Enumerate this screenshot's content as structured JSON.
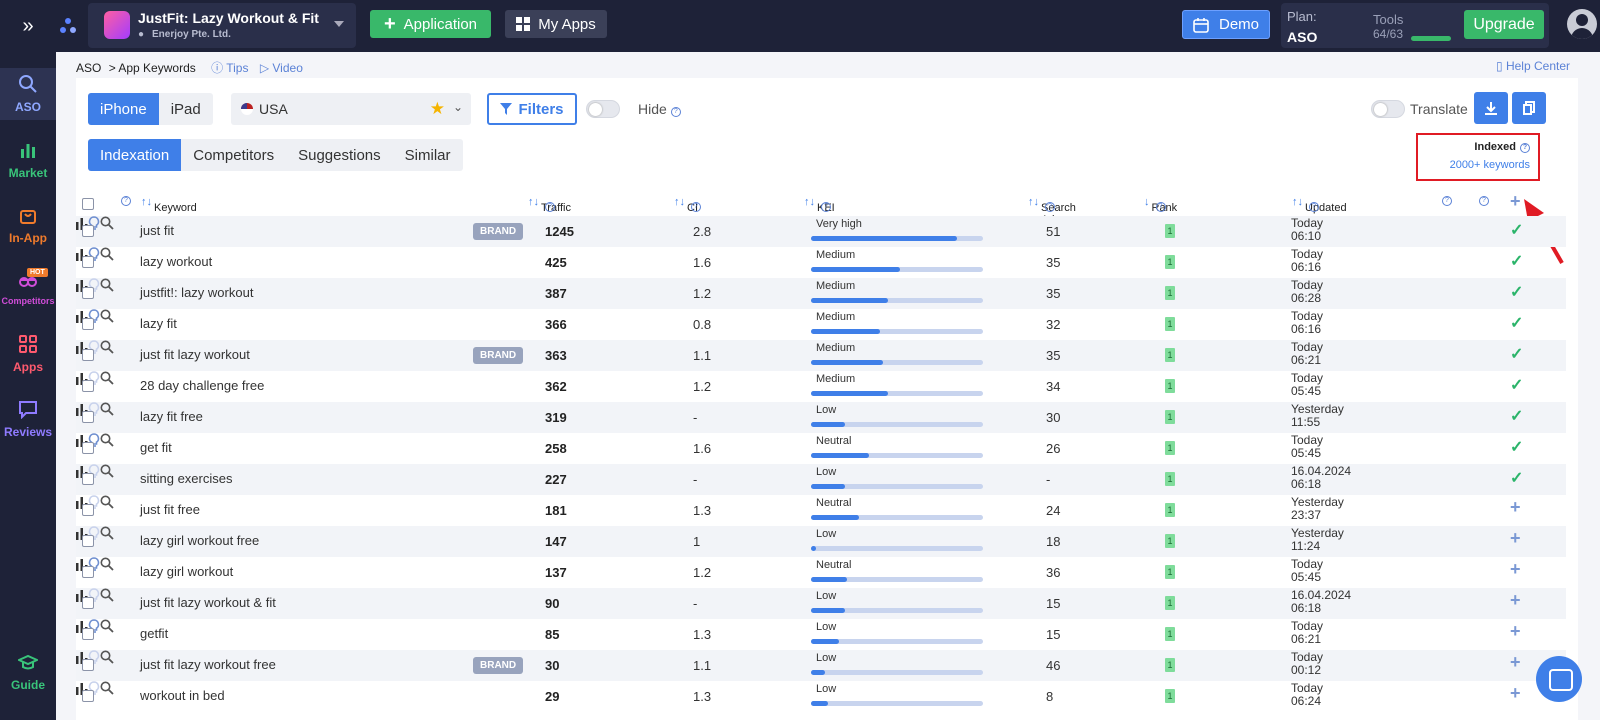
{
  "topbar": {
    "app_title": "JustFit: Lazy Workout & Fit",
    "developer": "Enerjoy Pte. Ltd.",
    "add_app_label": "Application",
    "my_apps_label": "My Apps",
    "demo_label": "Demo",
    "plan_label": "Plan:",
    "plan_value": "ASO",
    "tools_label": "Tools",
    "tools_value": "64/63",
    "upgrade_label": "Upgrade"
  },
  "sidebar": {
    "items": [
      {
        "label": "ASO",
        "icon": "search-icon",
        "color": "#8fa8ff"
      },
      {
        "label": "Market",
        "icon": "bar-chart-icon",
        "color": "#39c47a"
      },
      {
        "label": "In-App",
        "icon": "bag-icon",
        "color": "#f07b2c"
      },
      {
        "label": "Competitors",
        "icon": "glasses-icon",
        "color": "#d04dd9",
        "badge": "HOT"
      },
      {
        "label": "Apps",
        "icon": "grid-icon",
        "color": "#ff5a6e"
      },
      {
        "label": "Reviews",
        "icon": "chat-icon",
        "color": "#8f7bff"
      },
      {
        "label": "Guide",
        "icon": "graduation-cap-icon",
        "color": "#39c47a"
      }
    ]
  },
  "breadcrumb": {
    "root": "ASO",
    "current": "> App Keywords",
    "tips": "Tips",
    "video": "Video",
    "help": "Help Center"
  },
  "toolbar": {
    "device_tabs": [
      "iPhone",
      "iPad"
    ],
    "active_device": "iPhone",
    "country": "USA",
    "filters_label": "Filters",
    "hide_label": "Hide",
    "translate_label": "Translate"
  },
  "view_tabs": {
    "items": [
      "Indexation",
      "Competitors",
      "Suggestions",
      "Similar"
    ],
    "active": "Indexation"
  },
  "indexed": {
    "title": "Indexed",
    "value": "2000+ keywords"
  },
  "table": {
    "headers": {
      "keyword": "Keyword",
      "traffic": "Traffic",
      "ci": "CI",
      "kei": "KEI",
      "search_ads": "Search Ads",
      "rank": "Rank",
      "updated": "Updated"
    },
    "brand_label": "BRAND",
    "rows": [
      {
        "keyword": "just fit",
        "brand": true,
        "traffic": "1245",
        "ci": "2.8",
        "kei": "Very high",
        "kei_level": 0.85,
        "search_ads": "51",
        "rank": "1",
        "updated_day": "Today",
        "updated_time": "06:10",
        "bulb_on": true,
        "added": true
      },
      {
        "keyword": "lazy workout",
        "brand": false,
        "traffic": "425",
        "ci": "1.6",
        "kei": "Medium",
        "kei_level": 0.52,
        "search_ads": "35",
        "rank": "1",
        "updated_day": "Today",
        "updated_time": "06:16",
        "bulb_on": true,
        "added": true
      },
      {
        "keyword": "justfit!: lazy workout",
        "brand": false,
        "traffic": "387",
        "ci": "1.2",
        "kei": "Medium",
        "kei_level": 0.45,
        "search_ads": "35",
        "rank": "1",
        "updated_day": "Today",
        "updated_time": "06:28",
        "bulb_on": false,
        "added": true
      },
      {
        "keyword": "lazy fit",
        "brand": false,
        "traffic": "366",
        "ci": "0.8",
        "kei": "Medium",
        "kei_level": 0.4,
        "search_ads": "32",
        "rank": "1",
        "updated_day": "Today",
        "updated_time": "06:16",
        "bulb_on": true,
        "added": true
      },
      {
        "keyword": "just fit lazy workout",
        "brand": true,
        "traffic": "363",
        "ci": "1.1",
        "kei": "Medium",
        "kei_level": 0.42,
        "search_ads": "35",
        "rank": "1",
        "updated_day": "Today",
        "updated_time": "06:21",
        "bulb_on": false,
        "added": true
      },
      {
        "keyword": "28 day challenge free",
        "brand": false,
        "traffic": "362",
        "ci": "1.2",
        "kei": "Medium",
        "kei_level": 0.45,
        "search_ads": "34",
        "rank": "1",
        "updated_day": "Today",
        "updated_time": "05:45",
        "bulb_on": false,
        "added": true
      },
      {
        "keyword": "lazy fit free",
        "brand": false,
        "traffic": "319",
        "ci": "-",
        "kei": "Low",
        "kei_level": 0.2,
        "search_ads": "30",
        "rank": "1",
        "updated_day": "Yesterday",
        "updated_time": "11:55",
        "bulb_on": false,
        "added": true
      },
      {
        "keyword": "get fit",
        "brand": false,
        "traffic": "258",
        "ci": "1.6",
        "kei": "Neutral",
        "kei_level": 0.34,
        "search_ads": "26",
        "rank": "1",
        "updated_day": "Today",
        "updated_time": "05:45",
        "bulb_on": true,
        "added": true
      },
      {
        "keyword": "sitting exercises",
        "brand": false,
        "traffic": "227",
        "ci": "-",
        "kei": "Low",
        "kei_level": 0.2,
        "search_ads": "-",
        "rank": "1",
        "updated_day": "16.04.2024",
        "updated_time": "06:18",
        "bulb_on": false,
        "added": true
      },
      {
        "keyword": "just fit free",
        "brand": false,
        "traffic": "181",
        "ci": "1.3",
        "kei": "Neutral",
        "kei_level": 0.28,
        "search_ads": "24",
        "rank": "1",
        "updated_day": "Yesterday",
        "updated_time": "23:37",
        "bulb_on": false,
        "added": false
      },
      {
        "keyword": "lazy girl workout free",
        "brand": false,
        "traffic": "147",
        "ci": "1",
        "kei": "Low",
        "kei_level": 0.03,
        "search_ads": "18",
        "rank": "1",
        "updated_day": "Yesterday",
        "updated_time": "11:24",
        "bulb_on": false,
        "added": false
      },
      {
        "keyword": "lazy girl workout",
        "brand": false,
        "traffic": "137",
        "ci": "1.2",
        "kei": "Neutral",
        "kei_level": 0.21,
        "search_ads": "36",
        "rank": "1",
        "updated_day": "Today",
        "updated_time": "05:45",
        "bulb_on": true,
        "added": false
      },
      {
        "keyword": "just fit lazy workout & fit",
        "brand": false,
        "traffic": "90",
        "ci": "-",
        "kei": "Low",
        "kei_level": 0.2,
        "search_ads": "15",
        "rank": "1",
        "updated_day": "16.04.2024",
        "updated_time": "06:18",
        "bulb_on": false,
        "added": false
      },
      {
        "keyword": "getfit",
        "brand": false,
        "traffic": "85",
        "ci": "1.3",
        "kei": "Low",
        "kei_level": 0.16,
        "search_ads": "15",
        "rank": "1",
        "updated_day": "Today",
        "updated_time": "06:21",
        "bulb_on": true,
        "added": false
      },
      {
        "keyword": "just fit lazy workout free",
        "brand": true,
        "traffic": "30",
        "ci": "1.1",
        "kei": "Low",
        "kei_level": 0.08,
        "search_ads": "46",
        "rank": "1",
        "updated_day": "Today",
        "updated_time": "00:12",
        "bulb_on": false,
        "added": false
      },
      {
        "keyword": "workout in bed",
        "brand": false,
        "traffic": "29",
        "ci": "1.3",
        "kei": "Low",
        "kei_level": 0.1,
        "search_ads": "8",
        "rank": "1",
        "updated_day": "Today",
        "updated_time": "06:24",
        "bulb_on": false,
        "added": false
      }
    ]
  }
}
